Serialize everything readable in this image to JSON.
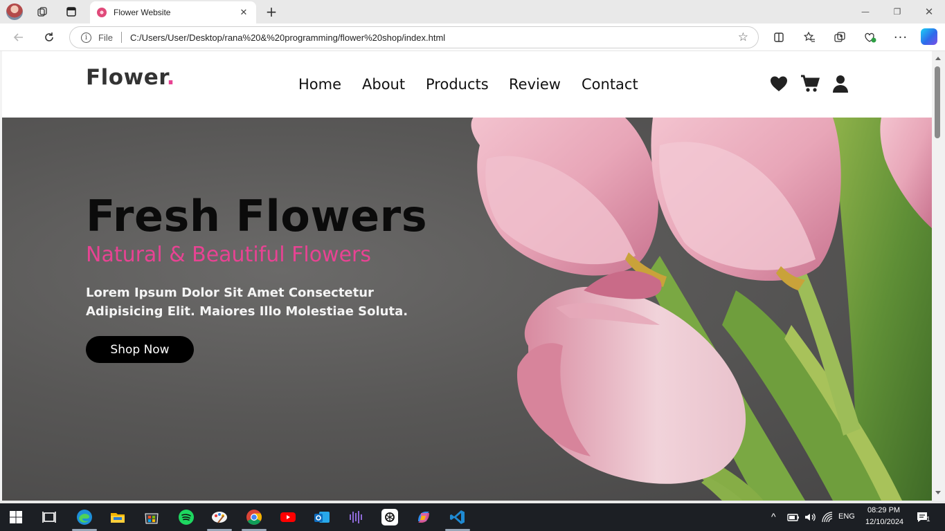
{
  "browser": {
    "tab_title": "Flower Website",
    "file_label": "File",
    "url": "C:/Users/User/Desktop/rana%20&%20programming/flower%20shop/index.html"
  },
  "site": {
    "logo_text": "Flower",
    "logo_dot": ".",
    "nav": [
      "Home",
      "About",
      "Products",
      "Review",
      "Contact"
    ],
    "icons": [
      "heart-icon",
      "cart-icon",
      "user-icon"
    ],
    "accent_color": "#e84393"
  },
  "hero": {
    "title": "Fresh Flowers",
    "subtitle": "Natural & Beautiful Flowers",
    "text": "Lorem Ipsum Dolor Sit Amet Consectetur Adipisicing Elit. Maiores Illo Molestiae Soluta.",
    "button_label": "Shop Now"
  },
  "taskbar": {
    "time": "08:29 PM",
    "date": "12/10/2024",
    "language": "ENG",
    "notification_count": "1"
  }
}
